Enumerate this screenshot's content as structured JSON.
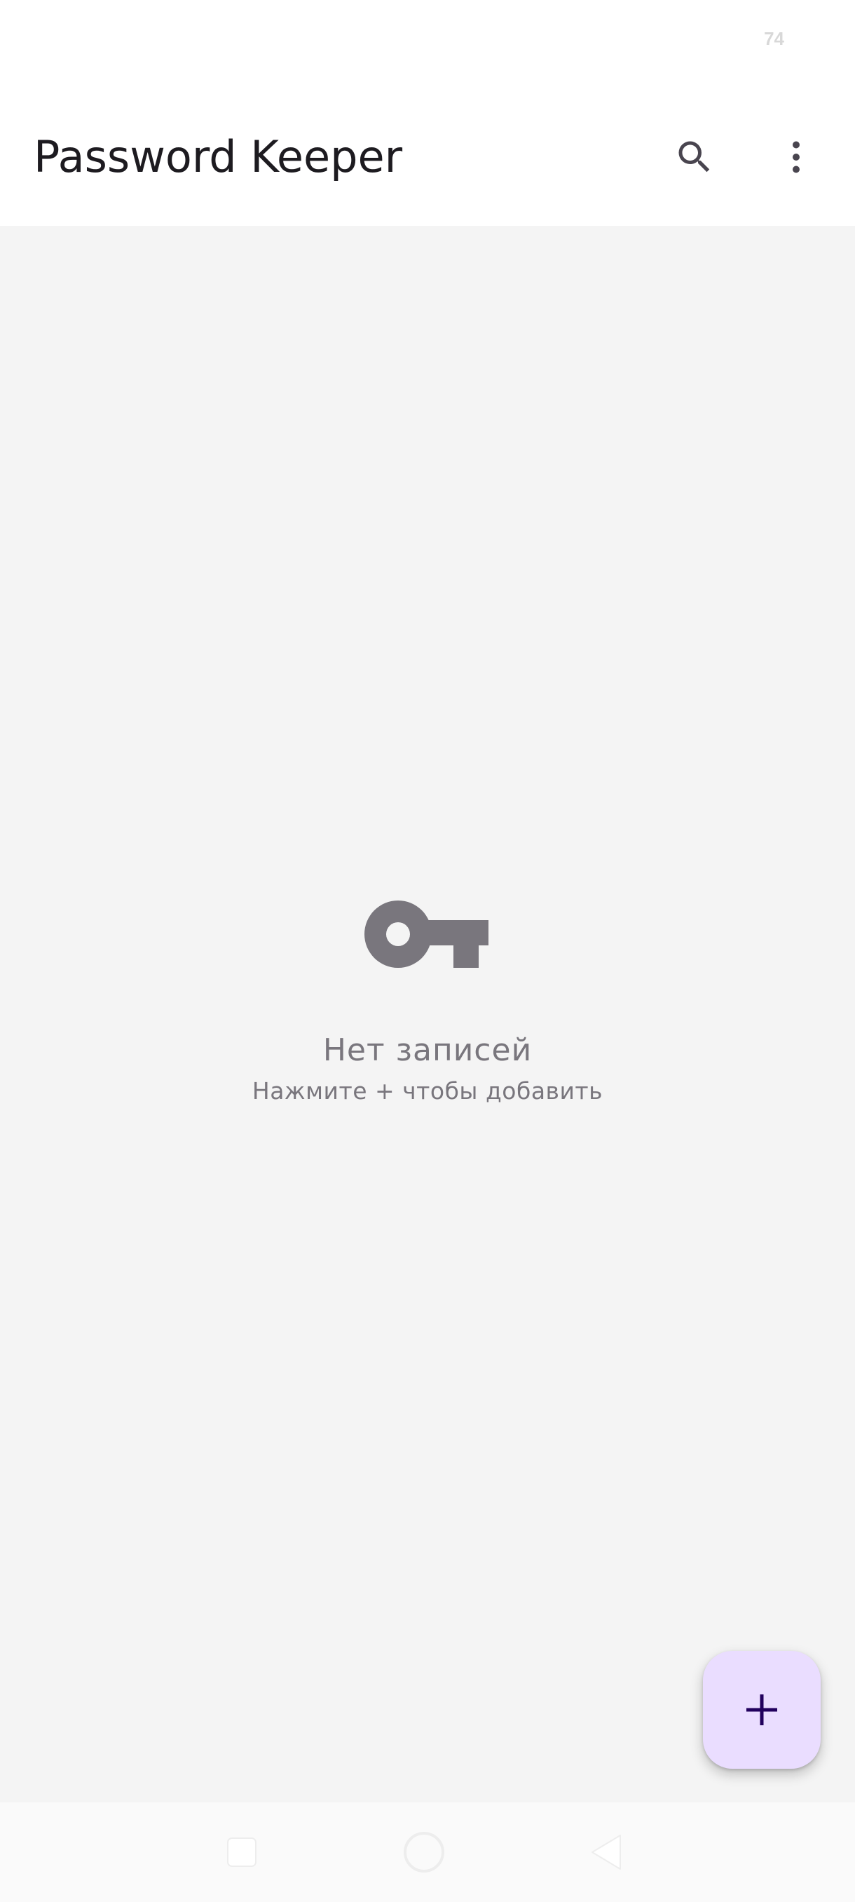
{
  "status_bar": {
    "battery": "74"
  },
  "app_bar": {
    "title": "Password Keeper",
    "search_icon": "search-icon",
    "more_icon": "more-vert-icon"
  },
  "empty_state": {
    "icon": "key-icon",
    "title": "Нет записей",
    "subtitle": "Нажмите + чтобы добавить"
  },
  "fab": {
    "icon": "plus-icon"
  },
  "navigation_bar": {
    "buttons": [
      "recents",
      "home",
      "back"
    ]
  },
  "colors": {
    "app_bar_background": "#ffffff",
    "content_background": "#f4f4f4",
    "title_text": "#1d1b20",
    "empty_state": "#79767d",
    "fab_background": "#eaddff",
    "fab_icon": "#21005d"
  }
}
